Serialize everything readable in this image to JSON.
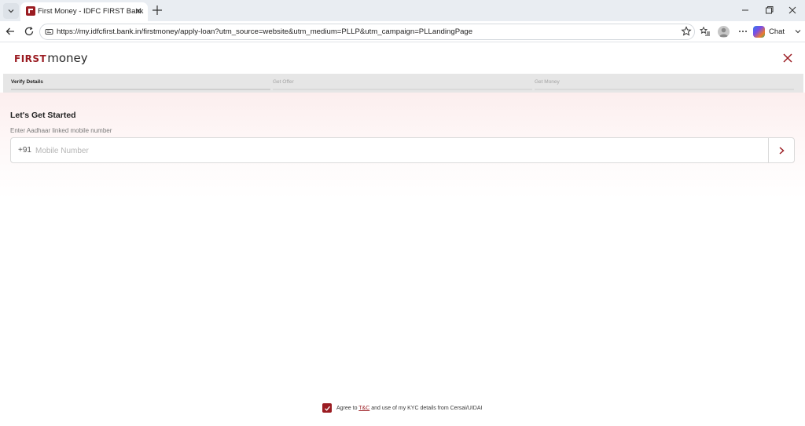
{
  "browser": {
    "tab_title": "First Money - IDFC FIRST Bank",
    "url": "https://my.idfcfirst.bank.in/firstmoney/apply-loan?utm_source=website&utm_medium=PLLP&utm_campaign=PLLandingPage",
    "chat_label": "Chat",
    "accent_color": "#9b1c22"
  },
  "header": {
    "logo_first": "FIRST",
    "logo_money": "money"
  },
  "steps": [
    {
      "label": "Verify Details",
      "state": "active"
    },
    {
      "label": "Get Offer",
      "state": "inactive"
    },
    {
      "label": "Get Money",
      "state": "inactive"
    }
  ],
  "form": {
    "heading": "Let's Get Started",
    "mobile_label": "Enter Aadhaar linked mobile number",
    "country_code": "+91",
    "mobile_placeholder": "Mobile Number",
    "mobile_value": ""
  },
  "consent": {
    "checked": true,
    "prefix": "Agree to ",
    "link": "T&C",
    "suffix": " and use of my KYC details from Cersai/UIDAI"
  }
}
